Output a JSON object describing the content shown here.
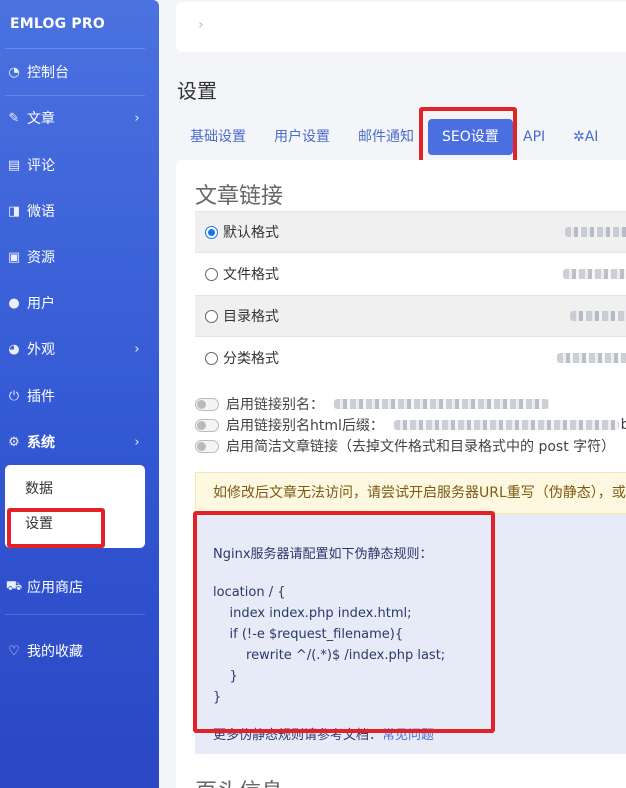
{
  "sidebar": {
    "brand": "EMLOG PRO",
    "items": [
      {
        "label": "控制台",
        "icon": "dashboard-icon",
        "glyph": "◔"
      },
      {
        "label": "文章",
        "icon": "pencil-icon",
        "glyph": "✎"
      },
      {
        "label": "评论",
        "icon": "comment-icon",
        "glyph": "▤"
      },
      {
        "label": "微语",
        "icon": "book-icon",
        "glyph": "◨"
      },
      {
        "label": "资源",
        "icon": "image-icon",
        "glyph": "▣"
      },
      {
        "label": "用户",
        "icon": "user-icon",
        "glyph": "●"
      },
      {
        "label": "外观",
        "icon": "palette-icon",
        "glyph": "◕"
      },
      {
        "label": "插件",
        "icon": "plug-icon",
        "glyph": "⏻"
      },
      {
        "label": "系统",
        "icon": "gear-icon",
        "glyph": "⚙"
      },
      {
        "label": "应用商店",
        "icon": "cart-icon",
        "glyph": "⛟"
      },
      {
        "label": "我的收藏",
        "icon": "heart-icon",
        "glyph": "♡"
      }
    ],
    "submenu": [
      {
        "label": "数据"
      },
      {
        "label": "设置"
      }
    ]
  },
  "topbar": {
    "crumb": "›"
  },
  "page": {
    "title": "设置"
  },
  "tabs": [
    {
      "label": "基础设置"
    },
    {
      "label": "用户设置"
    },
    {
      "label": "邮件通知"
    },
    {
      "label": "SEO设置"
    },
    {
      "label": "API"
    },
    {
      "label": "AI",
      "glyph": "✲"
    }
  ],
  "article_link": {
    "title": "文章链接",
    "formats": [
      {
        "label": "默认格式",
        "selected": true
      },
      {
        "label": "文件格式",
        "selected": false
      },
      {
        "label": "目录格式",
        "selected": false
      },
      {
        "label": "分类格式",
        "selected": false
      }
    ],
    "toggles": [
      {
        "label": "启用链接别名：",
        "suffix": ""
      },
      {
        "label": "启用链接别名html后缀：",
        "suffix": "bt"
      },
      {
        "label": "启用简洁文章链接（去掉文件格式和目录格式中的 post 字符）",
        "suffix": ""
      }
    ],
    "alert": "如修改后文章无法访问，请尝试开启服务器URL重写（伪静态），或",
    "nginx": {
      "heading": "Nginx服务器请配置如下伪静态规则：",
      "lines": [
        "location / {",
        "    index index.php index.html;",
        "    if (!-e $request_filename){",
        "        rewrite ^/(.*)$ /index.php last;",
        "    }",
        "}"
      ],
      "more_prefix": "更多伪静态规则请参考文档：",
      "more_link": "常见问题"
    }
  },
  "section2": {
    "title": "页头信息"
  }
}
